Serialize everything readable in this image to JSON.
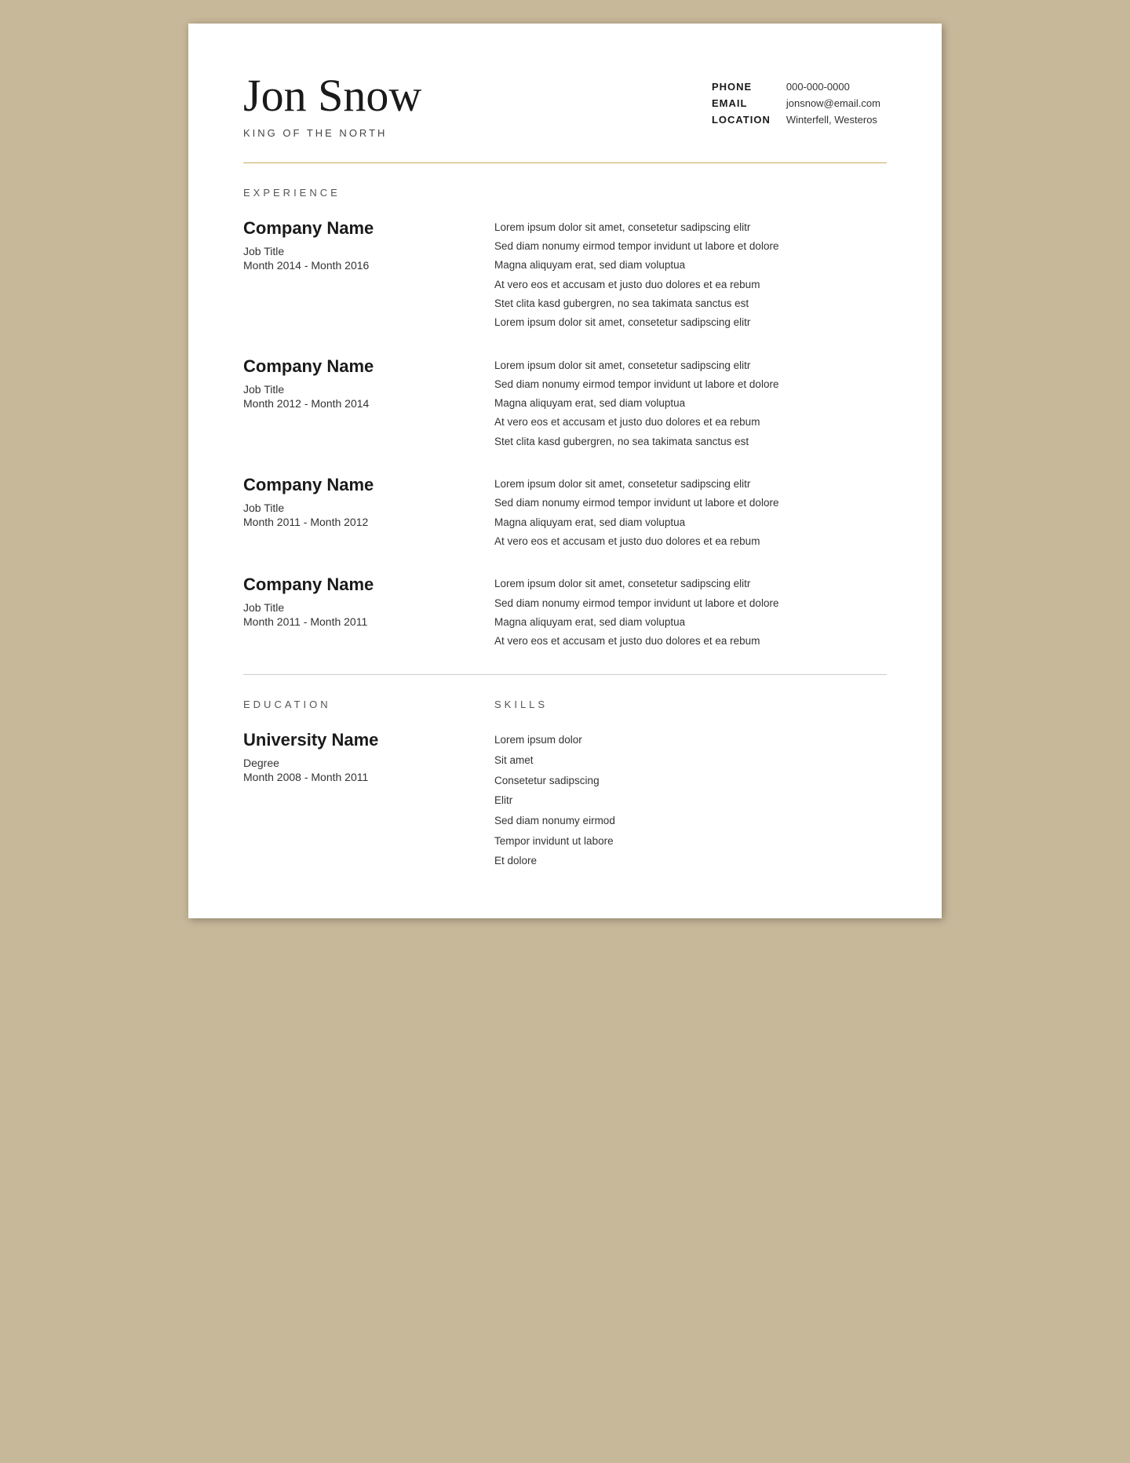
{
  "header": {
    "name": "Jon Snow",
    "subtitle": "KING OF THE NORTH",
    "contact": {
      "phone_label": "PHONE",
      "phone_value": "000-000-0000",
      "email_label": "EMAIL",
      "email_value": "jonsnow@email.com",
      "location_label": "LOCATION",
      "location_value": "Winterfell, Westeros"
    }
  },
  "sections": {
    "experience_label": "EXPERIENCE",
    "education_label": "EDUCATION",
    "skills_label": "SKILLS"
  },
  "experience": [
    {
      "company": "Company Name",
      "title": "Job Title",
      "dates": "Month 2014 - Month 2016",
      "description": [
        "Lorem ipsum dolor sit amet, consetetur sadipscing elitr",
        "Sed diam nonumy eirmod tempor invidunt ut labore et dolore",
        "Magna aliquyam erat, sed diam voluptua",
        "At vero eos et accusam et justo duo dolores et ea rebum",
        "Stet clita kasd gubergren, no sea takimata sanctus est",
        "Lorem ipsum dolor sit amet, consetetur sadipscing elitr"
      ]
    },
    {
      "company": "Company Name",
      "title": "Job Title",
      "dates": "Month 2012 - Month 2014",
      "description": [
        "Lorem ipsum dolor sit amet, consetetur sadipscing elitr",
        "Sed diam nonumy eirmod tempor invidunt ut labore et dolore",
        "Magna aliquyam erat, sed diam voluptua",
        "At vero eos et accusam et justo duo dolores et ea rebum",
        "Stet clita kasd gubergren, no sea takimata sanctus est"
      ]
    },
    {
      "company": "Company Name",
      "title": "Job Title",
      "dates": "Month 2011 - Month 2012",
      "description": [
        "Lorem ipsum dolor sit amet, consetetur sadipscing elitr",
        "Sed diam nonumy eirmod tempor invidunt ut labore et dolore",
        "Magna aliquyam erat, sed diam voluptua",
        "At vero eos et accusam et justo duo dolores et ea rebum"
      ]
    },
    {
      "company": "Company Name",
      "title": "Job Title",
      "dates": "Month 2011 - Month 2011",
      "description": [
        "Lorem ipsum dolor sit amet, consetetur sadipscing elitr",
        "Sed diam nonumy eirmod tempor invidunt ut labore et dolore",
        "Magna aliquyam erat, sed diam voluptua",
        "At vero eos et accusam et justo duo dolores et ea rebum"
      ]
    }
  ],
  "education": {
    "university": "University Name",
    "degree": "Degree",
    "dates": "Month 2008 - Month 2011"
  },
  "skills": [
    "Lorem ipsum dolor",
    "Sit amet",
    "Consetetur sadipscing",
    "Elitr",
    "Sed diam nonumy eirmod",
    "Tempor invidunt ut labore",
    "Et dolore"
  ]
}
